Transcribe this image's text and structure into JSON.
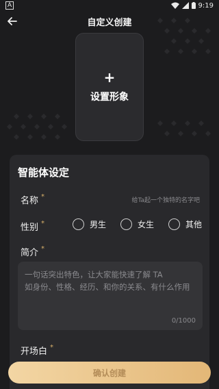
{
  "status_bar": {
    "left_icon": "A",
    "time": "9:19"
  },
  "header": {
    "title": "自定义创建"
  },
  "avatar": {
    "label": "设置形象",
    "plus": "+"
  },
  "form": {
    "section_title": "智能体设定",
    "name": {
      "label": "名称",
      "required": "*",
      "placeholder": "给Ta起一个独特的名字吧"
    },
    "gender": {
      "label": "性别",
      "required": "*",
      "options": [
        "男生",
        "女生",
        "其他"
      ]
    },
    "intro": {
      "label": "简介",
      "required": "*",
      "placeholder_line1": "一句话突出特色，让大家能快速了解 TA",
      "placeholder_line2": "如身份、性格、经历、和你的关系、有什么作用",
      "counter": "0/1000"
    },
    "opening": {
      "label": "开场白",
      "required": "*"
    }
  },
  "footer": {
    "confirm_label": "确认创建"
  },
  "colors": {
    "background": "#1c1c1e",
    "panel": "#29292c",
    "accent_gold": "#e3b777",
    "required_star": "#d8b06a"
  },
  "icons": [
    "back-arrow-icon",
    "wifi-icon",
    "signal-icon",
    "battery-icon",
    "plus-icon"
  ]
}
